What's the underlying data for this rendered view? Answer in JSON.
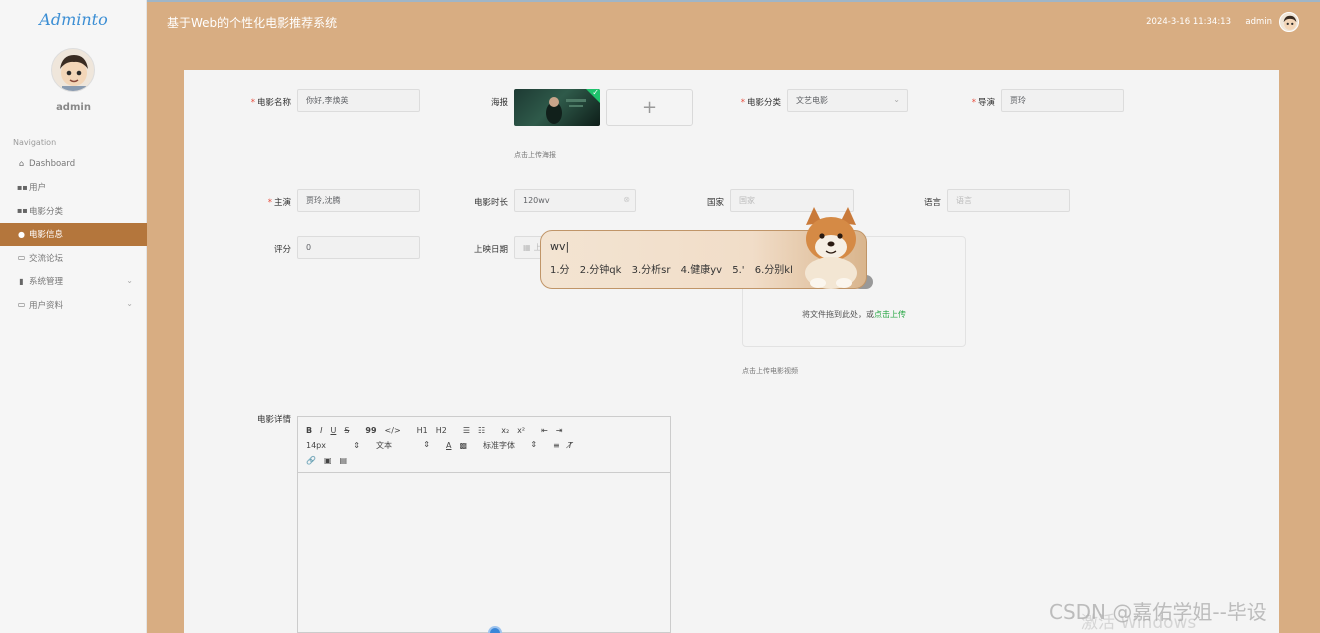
{
  "sidebar": {
    "logo": "Adminto",
    "user_name": "admin",
    "nav_heading": "Navigation",
    "items": [
      {
        "label": "Dashboard",
        "icon": "home-icon"
      },
      {
        "label": "用户",
        "icon": "grid-icon"
      },
      {
        "label": "电影分类",
        "icon": "grid-icon"
      },
      {
        "label": "电影信息",
        "icon": "person-icon",
        "active": true
      },
      {
        "label": "交流论坛",
        "icon": "doc-icon"
      },
      {
        "label": "系统管理",
        "icon": "chart-icon",
        "expandable": true
      },
      {
        "label": "用户资料",
        "icon": "card-icon",
        "expandable": true
      }
    ]
  },
  "header": {
    "title": "基于Web的个性化电影推荐系统",
    "datetime": "2024-3-16 11:34:13",
    "user": "admin"
  },
  "form": {
    "name": {
      "label": "电影名称",
      "value": "你好,李焕英"
    },
    "poster": {
      "label": "海报",
      "plus": "+",
      "hint": "点击上传海报"
    },
    "category": {
      "label": "电影分类",
      "value": "文艺电影"
    },
    "director": {
      "label": "导演",
      "value": "贾玲"
    },
    "actors": {
      "label": "主演",
      "value": "贾玲,沈腾"
    },
    "duration": {
      "label": "电影时长",
      "value": "120wv"
    },
    "country": {
      "label": "国家",
      "placeholder": "国家"
    },
    "language": {
      "label": "语言",
      "placeholder": "语言"
    },
    "rating": {
      "label": "评分",
      "value": "0"
    },
    "release_date": {
      "label": "上映日期",
      "placeholder": "上"
    },
    "video": {
      "drop_text": "将文件拖到此处，或",
      "drop_link": "点击上传",
      "hint": "点击上传电影视频"
    },
    "detail": {
      "label": "电影详情"
    }
  },
  "editor": {
    "row1": [
      "B",
      "I",
      "U",
      "S",
      "99",
      "</>",
      "H1",
      "H2",
      "☰",
      "☷",
      "x₂",
      "x²",
      "⇤",
      "⇥"
    ],
    "font_size": "14px",
    "text_style": "文本",
    "font_family": "标准字体",
    "color_icon": "A"
  },
  "ime": {
    "composition": "wv",
    "candidates": [
      "1.分",
      "2.分钟qk",
      "3.分析sr",
      "4.健康yv",
      "5.'",
      "6.分别kl"
    ]
  },
  "watermark": {
    "csdn": "CSDN @嘉佑学姐--毕设",
    "windows": "激活 Windows"
  },
  "colors": {
    "background": "#d8ad82",
    "active_nav": "#b4763c",
    "link": "#28a745",
    "required": "#e74c3c"
  }
}
